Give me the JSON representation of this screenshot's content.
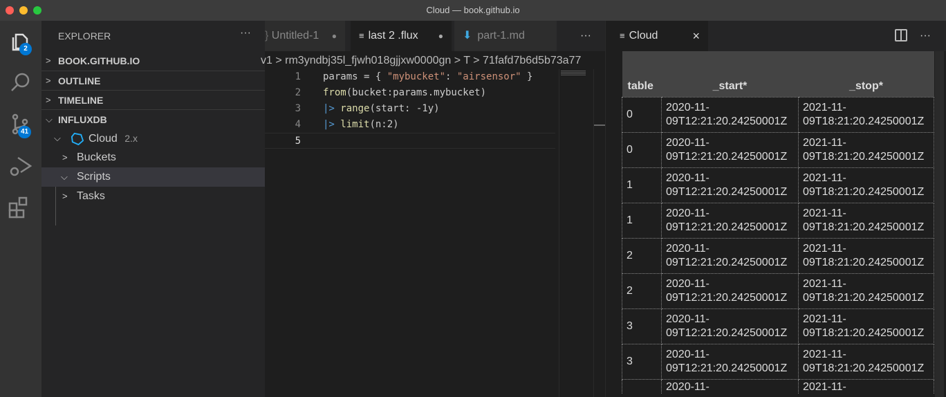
{
  "window": {
    "title": "Cloud — book.github.io"
  },
  "activity": {
    "explorer_badge": "2",
    "scm_badge": "41"
  },
  "sidebar": {
    "title": "EXPLORER",
    "sections": [
      "BOOK.GITHUB.IO",
      "OUTLINE",
      "TIMELINE",
      "INFLUXDB"
    ],
    "tree": {
      "connection": "Cloud",
      "connection_version": "2.x",
      "items": [
        "Buckets",
        "Scripts",
        "Tasks"
      ]
    }
  },
  "editor": {
    "tabs": [
      "Untitled-1",
      "last 2 .flux",
      "part-1.md"
    ],
    "breadcrumb": [
      "v1",
      "rm3yndbj35l_fjwh018gjjxw0000gn",
      "T",
      "71fafd7b6d5b73a77"
    ],
    "lines": [
      "1",
      "2",
      "3",
      "4",
      "5"
    ],
    "code": {
      "l1a": "params = { ",
      "l1b": "\"mybucket\"",
      "l1c": ": ",
      "l1d": "\"airsensor\"",
      "l1e": " }",
      "l2a": "from",
      "l2b": "(bucket:params.mybucket)",
      "pipe": "|>",
      "l3a": "range",
      "l3b": "(start: -1y)",
      "l4a": "limit",
      "l4b": "(n:2)"
    }
  },
  "panel": {
    "tab": "Cloud",
    "headers": [
      "table",
      "_start*",
      "_stop*"
    ],
    "rows": [
      [
        "0",
        "2020-11-09T12:21:20.24250001Z",
        "2021-11-09T18:21:20.24250001Z"
      ],
      [
        "0",
        "2020-11-09T12:21:20.24250001Z",
        "2021-11-09T18:21:20.24250001Z"
      ],
      [
        "1",
        "2020-11-09T12:21:20.24250001Z",
        "2021-11-09T18:21:20.24250001Z"
      ],
      [
        "1",
        "2020-11-09T12:21:20.24250001Z",
        "2021-11-09T18:21:20.24250001Z"
      ],
      [
        "2",
        "2020-11-09T12:21:20.24250001Z",
        "2021-11-09T18:21:20.24250001Z"
      ],
      [
        "2",
        "2020-11-09T12:21:20.24250001Z",
        "2021-11-09T18:21:20.24250001Z"
      ],
      [
        "3",
        "2020-11-09T12:21:20.24250001Z",
        "2021-11-09T18:21:20.24250001Z"
      ],
      [
        "3",
        "2020-11-09T12:21:20.24250001Z",
        "2021-11-09T18:21:20.24250001Z"
      ],
      [
        "",
        "2020-11-",
        "2021-11-"
      ]
    ]
  }
}
